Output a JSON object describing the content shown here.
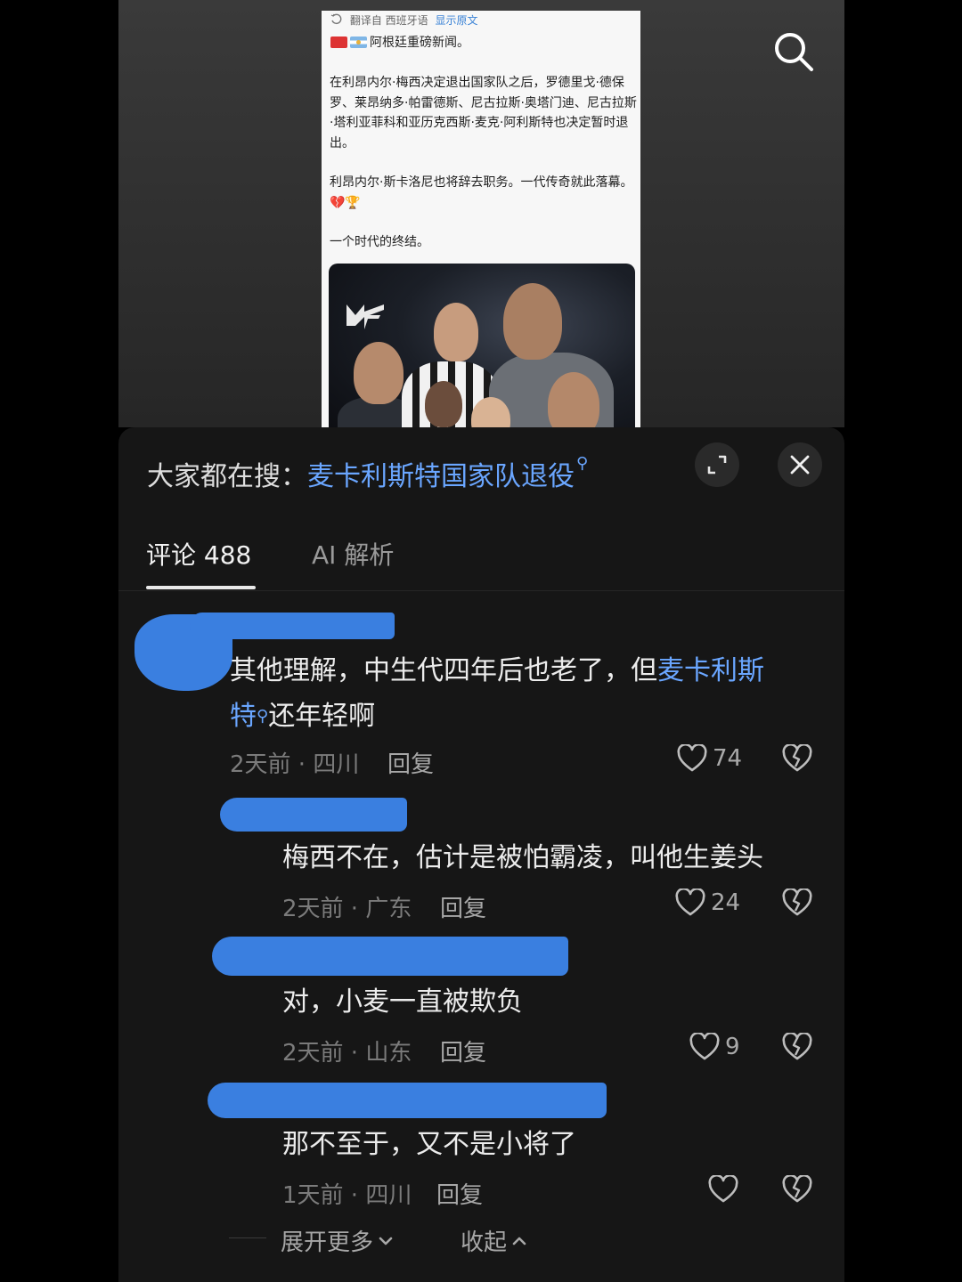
{
  "post": {
    "translate_label": "翻译自 西班牙语",
    "show_original": "显示原文",
    "headline": "阿根廷重磅新闻。",
    "paragraphs": [
      "在利昂内尔·梅西决定退出国家队之后，罗德里戈·德保罗、莱昂纳多·帕雷德斯、尼古拉斯·奥塔门迪、尼古拉斯·塔利亚菲科和亚历克西斯·麦克·阿利斯特也决定暂时退出。",
      "利昂内尔·斯卡洛尼也将辞去职务。一代传奇就此落幕。💔🏆",
      "一个时代的终结。"
    ]
  },
  "sheet": {
    "hot_search_prefix": "大家都在搜：",
    "hot_search_keyword": "麦卡利斯特国家队退役",
    "tabs": [
      {
        "label": "评论 488",
        "active": true
      },
      {
        "label": "AI 解析",
        "active": false
      }
    ]
  },
  "comments": [
    {
      "text_before": "其他理解，中生代四年后也老了，但",
      "mention_a": "麦卡利斯",
      "mention_b": "特",
      "text_after": "还年轻啊",
      "time_location": "2天前 · 四川",
      "reply": "回复",
      "likes": "74"
    },
    {
      "text": "梅西不在，估计是被怕霸凌，叫他生姜头",
      "time_location": "2天前 · 广东",
      "reply": "回复",
      "likes": "24"
    },
    {
      "text": "对，小麦一直被欺负",
      "time_location": "2天前 · 山东",
      "reply": "回复",
      "likes": "9"
    },
    {
      "text": "那不至于，又不是小将了",
      "time_location": "1天前 · 四川",
      "reply": "回复",
      "likes": ""
    }
  ],
  "footer": {
    "expand_more": "展开更多",
    "collapse": "收起"
  },
  "colors": {
    "background": "#000000",
    "sheet": "#161616",
    "link_blue": "#6aa6ff",
    "redaction_blue": "#3a7fe0"
  },
  "icons": [
    "search-icon",
    "expand-icon",
    "close-icon",
    "heart-icon",
    "broken-heart-icon",
    "chevron-down-icon",
    "chevron-up-icon",
    "translate-icon"
  ]
}
